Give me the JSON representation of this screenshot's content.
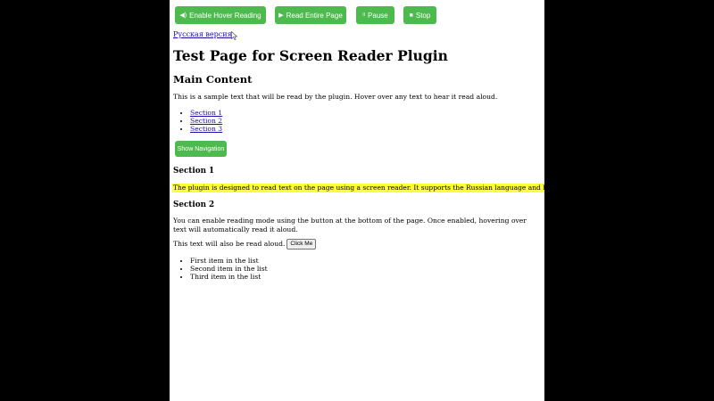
{
  "toolbar": {
    "hover_label": "Enable Hover Reading",
    "hover_icon": "◀)",
    "read_label": "Read Entire Page",
    "read_icon": "▶",
    "pause_label": "Pause",
    "pause_icon": "II",
    "stop_label": "Stop",
    "stop_icon": "■"
  },
  "lang_link": "Русская версия",
  "title": "Test Page for Screen Reader Plugin",
  "main": {
    "heading": "Main Content",
    "intro": "This is a sample text that will be read by the plugin. Hover over any text to hear it read aloud.",
    "toc": [
      "Section 1",
      "Section 2",
      "Section 3"
    ],
    "nav_button": "Show Navigation"
  },
  "section1": {
    "heading": "Section 1",
    "text": "The plugin is designed to read text on the page using a screen reader. It supports the Russian language and has user-friendly controls."
  },
  "section2": {
    "heading": "Section 2",
    "text": "You can enable reading mode using the button at the bottom of the page. Once enabled, hovering over text will automatically read it aloud.",
    "inline_text": "This text will also be read aloud.",
    "click_button": "Click Me",
    "list": [
      "First item in the list",
      "Second item in the list",
      "Third item in the list"
    ]
  },
  "colors": {
    "button_green": "#4cba4c",
    "highlight_yellow": "#ffff33",
    "link_blue": "#1a0dab",
    "side_background": "#000000"
  }
}
